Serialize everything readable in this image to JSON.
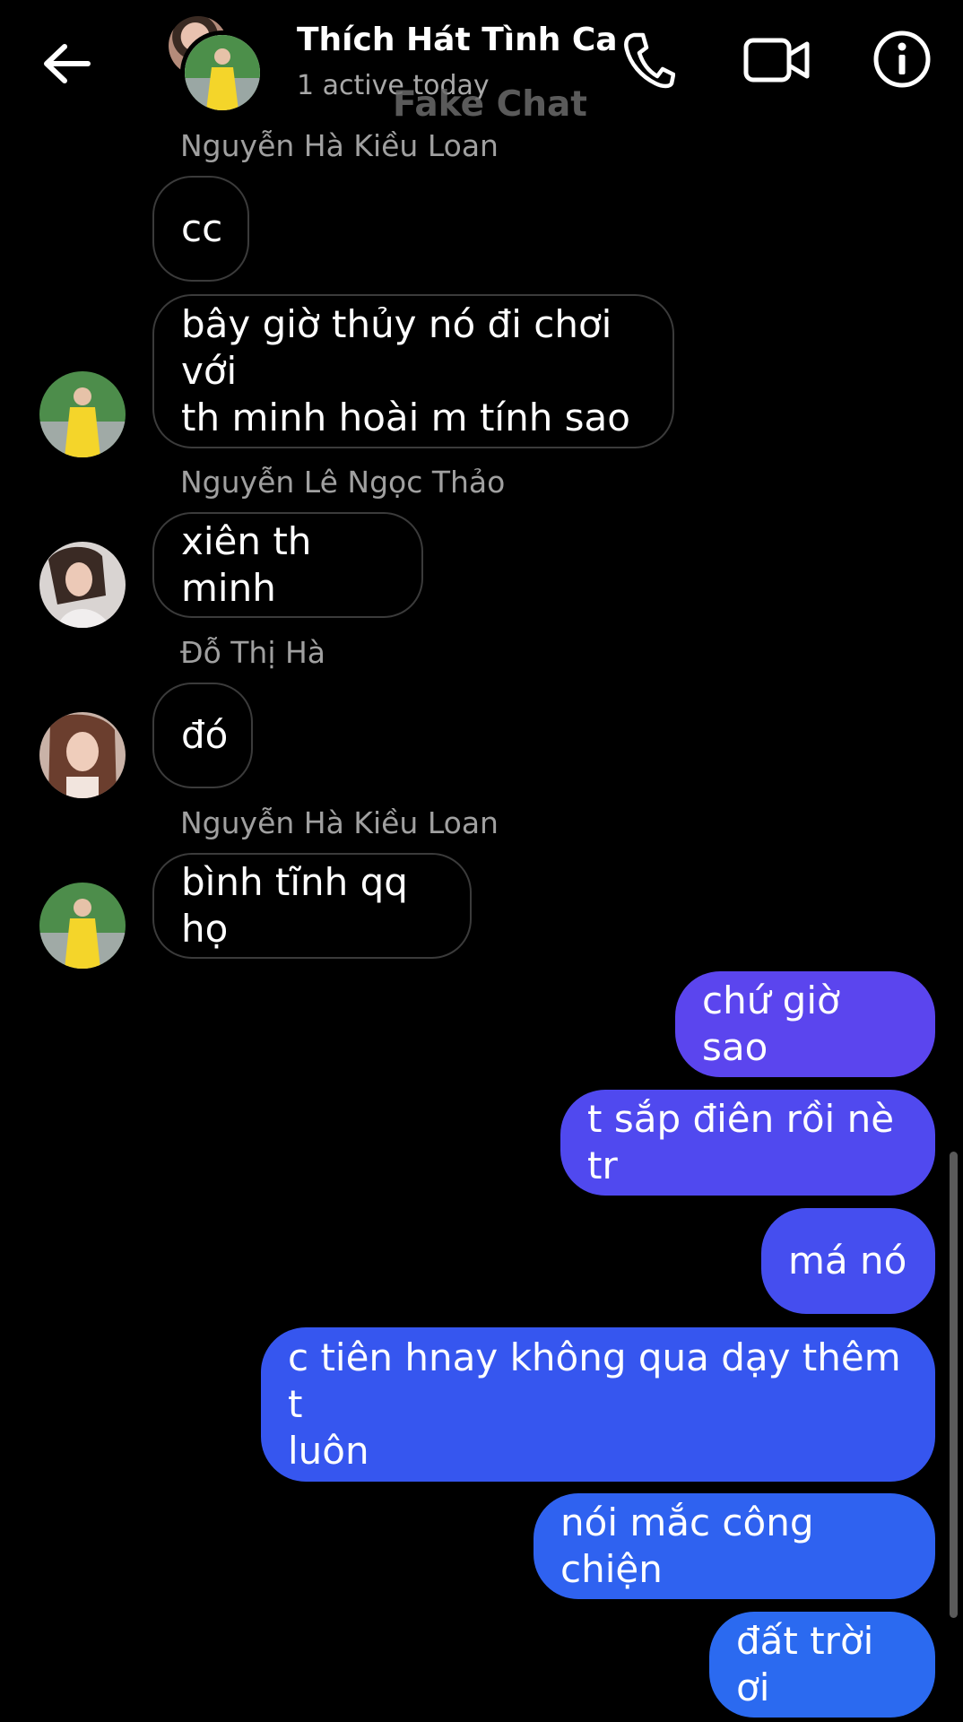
{
  "header": {
    "title": "Thích Hát Tình Ca",
    "subtitle": "1 active today",
    "watermark": "Fake Chat",
    "icons": [
      "back-arrow-icon",
      "phone-icon",
      "video-camera-icon",
      "info-icon"
    ]
  },
  "messages": {
    "sender1": "Nguyễn Hà Kiều Loan",
    "m1": "cc",
    "m2": "bây giờ thủy nó đi chơi với\nth minh hoài m tính sao",
    "sender2": "Nguyễn Lê Ngọc Thảo",
    "m3": "xiên th minh",
    "sender3": "Đỗ Thị Hà",
    "m4": "đó",
    "sender4": "Nguyễn Hà Kiều Loan",
    "m5": "bình tĩnh qq họ",
    "o1": "chứ giờ sao",
    "o2": "t sắp điên rồi nè tr",
    "o3": "má nó",
    "o4": "c tiên hnay không qua dạy thêm t\nluôn",
    "o5": "nói mắc công chiện",
    "o6": "đất trời ơi"
  },
  "colors": {
    "background": "#000000",
    "incoming_border": "#3b3b3b",
    "outgoing_top": "#5b46ee",
    "outgoing_bottom": "#2a6cf0"
  }
}
